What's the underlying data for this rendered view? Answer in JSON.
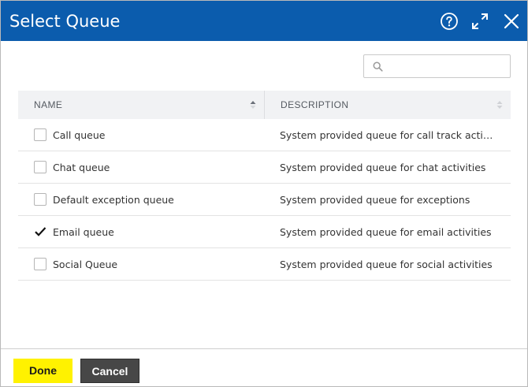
{
  "dialog": {
    "title": "Select Queue",
    "header_icons": [
      "help-icon",
      "expand-icon",
      "close-icon"
    ],
    "accent_color": "#0b5cad"
  },
  "search": {
    "value": "",
    "placeholder": "",
    "icon": "search-icon"
  },
  "table": {
    "columns": [
      {
        "label": "NAME",
        "sort": "ascending"
      },
      {
        "label": "DESCRIPTION",
        "sort": "none"
      }
    ],
    "rows": [
      {
        "name": "Call queue",
        "description": "System provided queue for call track activities",
        "checked": false
      },
      {
        "name": "Chat queue",
        "description": "System provided queue for chat activities",
        "checked": false
      },
      {
        "name": "Default exception queue",
        "description": "System provided queue for exceptions",
        "checked": false
      },
      {
        "name": "Email queue",
        "description": "System provided queue for email activities",
        "checked": true
      },
      {
        "name": "Social Queue",
        "description": "System provided queue for social activities",
        "checked": false
      }
    ]
  },
  "footer": {
    "done_label": "Done",
    "cancel_label": "Cancel",
    "done_color": "#fff200",
    "cancel_color": "#474747"
  }
}
